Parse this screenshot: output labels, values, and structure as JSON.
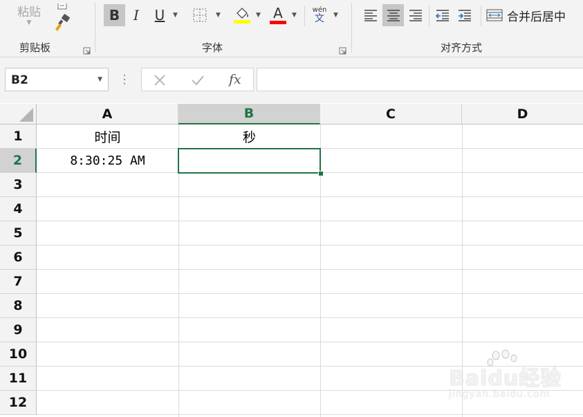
{
  "ribbon": {
    "clipboard": {
      "label": "剪贴板",
      "paste_label": "粘贴"
    },
    "font": {
      "label": "字体",
      "bold": "B",
      "italic": "I",
      "underline": "U",
      "font_color_glyph": "A",
      "phonetic_top": "wén",
      "phonetic_bottom": "文",
      "fill_color": "#ffff00",
      "font_color": "#ff0000"
    },
    "alignment": {
      "label": "对齐方式",
      "merge_label": "合并后居中"
    }
  },
  "formula_bar": {
    "name_box": "B2",
    "fx_label": "fx",
    "formula": ""
  },
  "sheet": {
    "columns": [
      "A",
      "B",
      "C",
      "D"
    ],
    "rows": [
      "1",
      "2",
      "3",
      "4",
      "5",
      "6",
      "7",
      "8",
      "9",
      "10",
      "11",
      "12"
    ],
    "selected_column": "B",
    "selected_row": "2",
    "cells": {
      "A1": "时间",
      "B1": "秒",
      "A2": "8:30:25 AM",
      "B2": ""
    },
    "accent_color": "#217346"
  },
  "watermark": {
    "line1": "Baidu经验",
    "line2": "jingyan.baidu.com"
  }
}
